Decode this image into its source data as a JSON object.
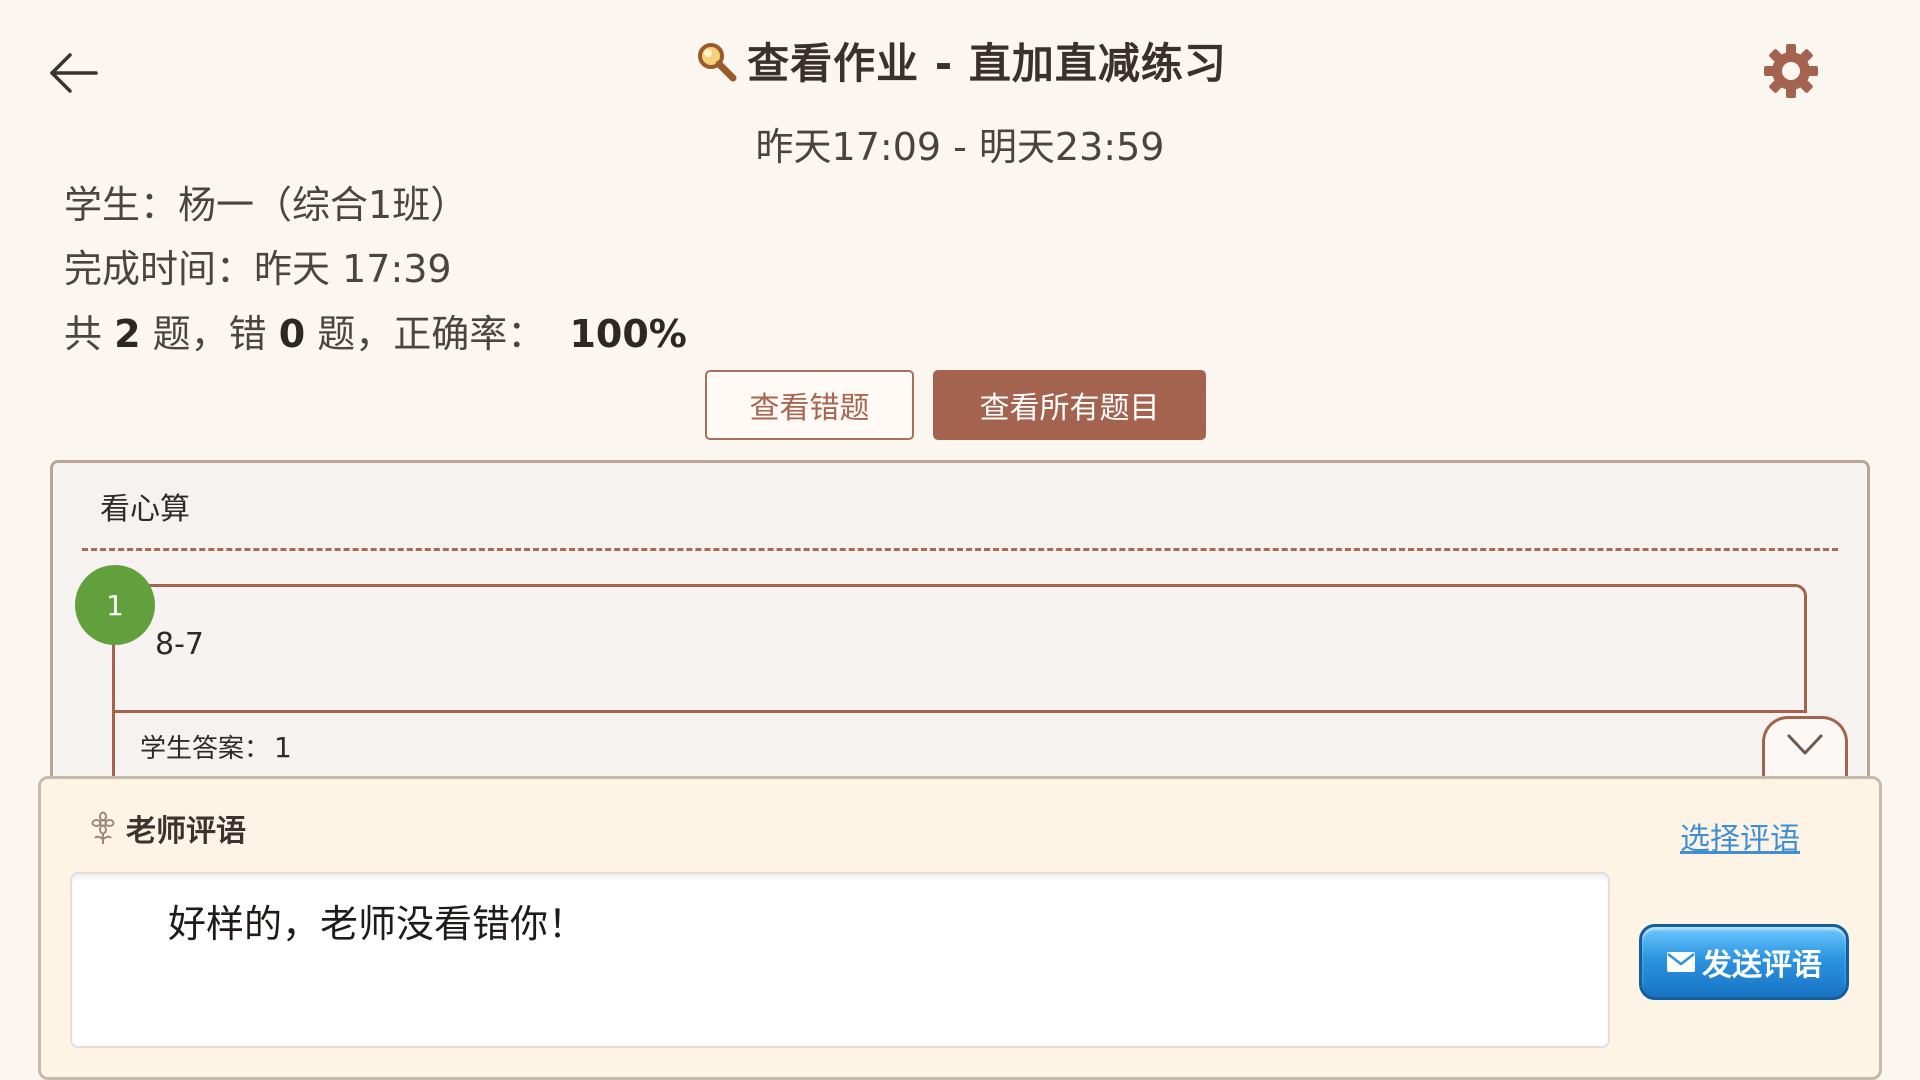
{
  "header": {
    "title": "查看作业 - 直加直减练习",
    "time_range": "昨天17:09 - 明天23:59",
    "icons": {
      "back": "back-arrow-icon",
      "title": "magnifier-icon",
      "settings": "gear-icon"
    }
  },
  "info": {
    "student_label": "学生：",
    "student_value": "杨一（综合1班）",
    "finish_label": "完成时间：",
    "finish_value": "昨天 17:39",
    "stats": {
      "prefix": "共 ",
      "total": "2",
      "mid1": " 题，错 ",
      "wrong": "0",
      "mid2": " 题，正确率：",
      "accuracy": "100%"
    }
  },
  "actions": {
    "view_wrong": "查看错题",
    "view_all": "查看所有题目"
  },
  "question_section": {
    "title": "看心算",
    "questions": [
      {
        "number": "1",
        "expression": "8-7",
        "answer_label": "学生答案：",
        "answer_value": "1"
      }
    ]
  },
  "comment": {
    "title": "老师评语",
    "select_link": "选择评语",
    "text": "好样的，老师没看错你！",
    "send_label": "发送评语",
    "icons": {
      "title": "flower-icon",
      "send": "mail-icon"
    }
  },
  "colors": {
    "background": "#fcf6f0",
    "accent": "#a4634f",
    "badge": "#62a03d",
    "link": "#3f8fd6",
    "send_button": "#2b94e0"
  }
}
